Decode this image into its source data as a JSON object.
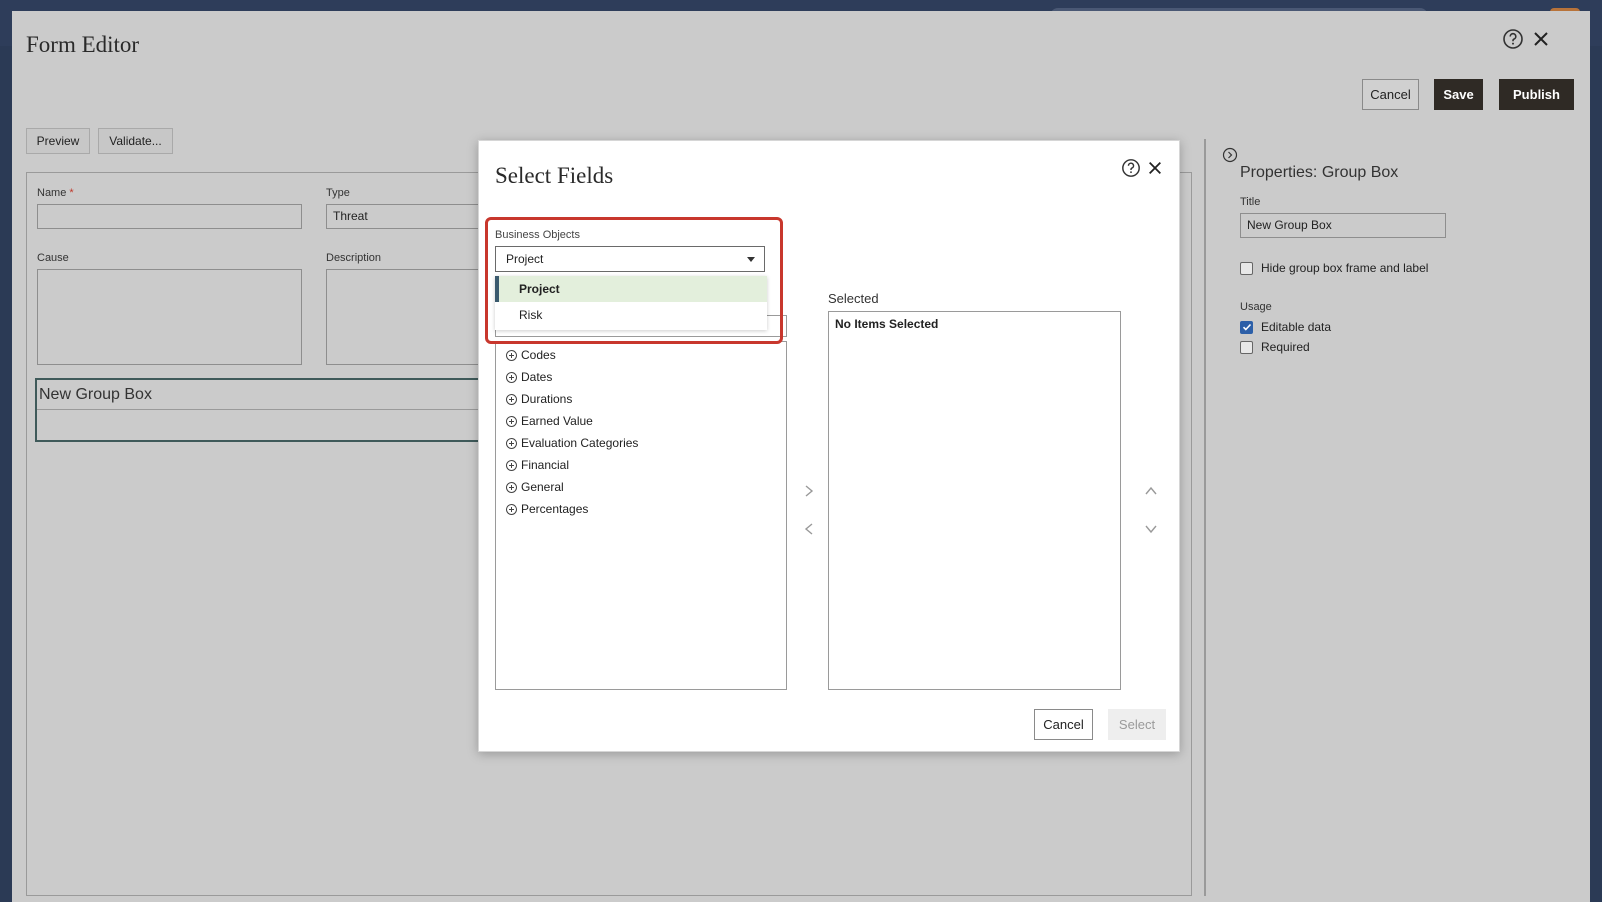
{
  "editor": {
    "title": "Form Editor",
    "cancel_label": "Cancel",
    "save_label": "Save",
    "publish_label": "Publish",
    "preview_label": "Preview",
    "validate_label": "Validate...",
    "fields": {
      "name_label": "Name",
      "name_required": "*",
      "name_value": "",
      "type_label": "Type",
      "type_value": "Threat",
      "cause_label": "Cause",
      "description_label": "Description"
    },
    "group_box_title": "New Group Box"
  },
  "properties": {
    "title": "Properties: Group Box",
    "title_label": "Title",
    "title_value": "New Group Box",
    "hide_frame_label": "Hide group box frame and label",
    "hide_frame_checked": false,
    "usage_label": "Usage",
    "editable_label": "Editable data",
    "editable_checked": true,
    "required_label": "Required",
    "required_checked": false
  },
  "modal": {
    "title": "Select Fields",
    "business_objects_label": "Business Objects",
    "selected_value": "Project",
    "dropdown_options": [
      {
        "label": "Project",
        "selected": true
      },
      {
        "label": "Risk",
        "selected": false
      }
    ],
    "available_items": [
      "Codes",
      "Dates",
      "Durations",
      "Earned Value",
      "Evaluation Categories",
      "Financial",
      "General",
      "Percentages"
    ],
    "selected_label": "Selected",
    "no_items_text": "No Items Selected",
    "cancel_label": "Cancel",
    "select_label": "Select"
  },
  "colors": {
    "accent_dark": "#2f2a25",
    "highlight": "#c8372d",
    "dropdown_selected_bg": "#e3efdc",
    "checkbox_checked": "#2c5fa8"
  }
}
